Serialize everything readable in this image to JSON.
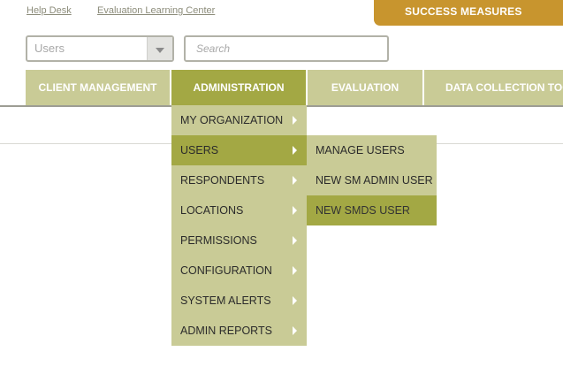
{
  "top_links": {
    "help_desk": "Help Desk",
    "learning_center": "Evaluation Learning Center"
  },
  "brand": {
    "label": "SUCCESS MEASURES"
  },
  "selector": {
    "value": "Users"
  },
  "search": {
    "placeholder": "Search"
  },
  "nav": {
    "tabs": [
      {
        "label": "CLIENT MANAGEMENT"
      },
      {
        "label": "ADMINISTRATION"
      },
      {
        "label": "EVALUATION"
      },
      {
        "label": "DATA COLLECTION TOOLS"
      }
    ]
  },
  "admin_menu": {
    "items": [
      {
        "label": "MY ORGANIZATION"
      },
      {
        "label": "USERS"
      },
      {
        "label": "RESPONDENTS"
      },
      {
        "label": "LOCATIONS"
      },
      {
        "label": "PERMISSIONS"
      },
      {
        "label": "CONFIGURATION"
      },
      {
        "label": "SYSTEM ALERTS"
      },
      {
        "label": "ADMIN REPORTS"
      }
    ]
  },
  "users_submenu": {
    "items": [
      {
        "label": "MANAGE USERS"
      },
      {
        "label": "NEW SM ADMIN USER"
      },
      {
        "label": "NEW SMDS USER"
      }
    ]
  },
  "colors": {
    "brand_gold": "#c8952e",
    "nav_olive_light": "#c9cb96",
    "nav_olive_active": "#a3a844"
  }
}
